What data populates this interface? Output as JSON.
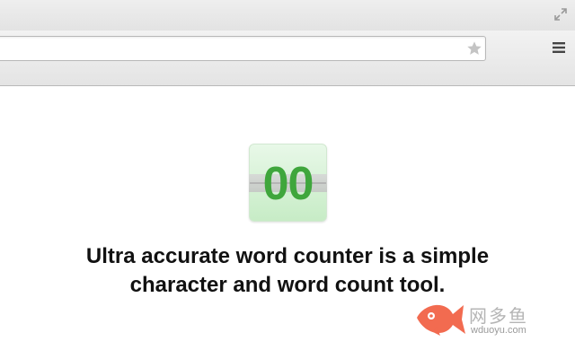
{
  "browser": {
    "address_value": "",
    "icons": {
      "fullscreen": "fullscreen-icon",
      "bookmark": "star-icon",
      "menu": "hamburger-menu-icon"
    }
  },
  "app": {
    "counter_display": "00",
    "headline_line1": "Ultra accurate word counter is a simple",
    "headline_line2": "character and word count tool."
  },
  "watermark": {
    "name": "网多鱼",
    "domain": "wduoyu.com"
  },
  "colors": {
    "counter_green": "#3fa63c",
    "icon_bg": "#d9f3d8",
    "watermark_fish": "#f26b50"
  }
}
